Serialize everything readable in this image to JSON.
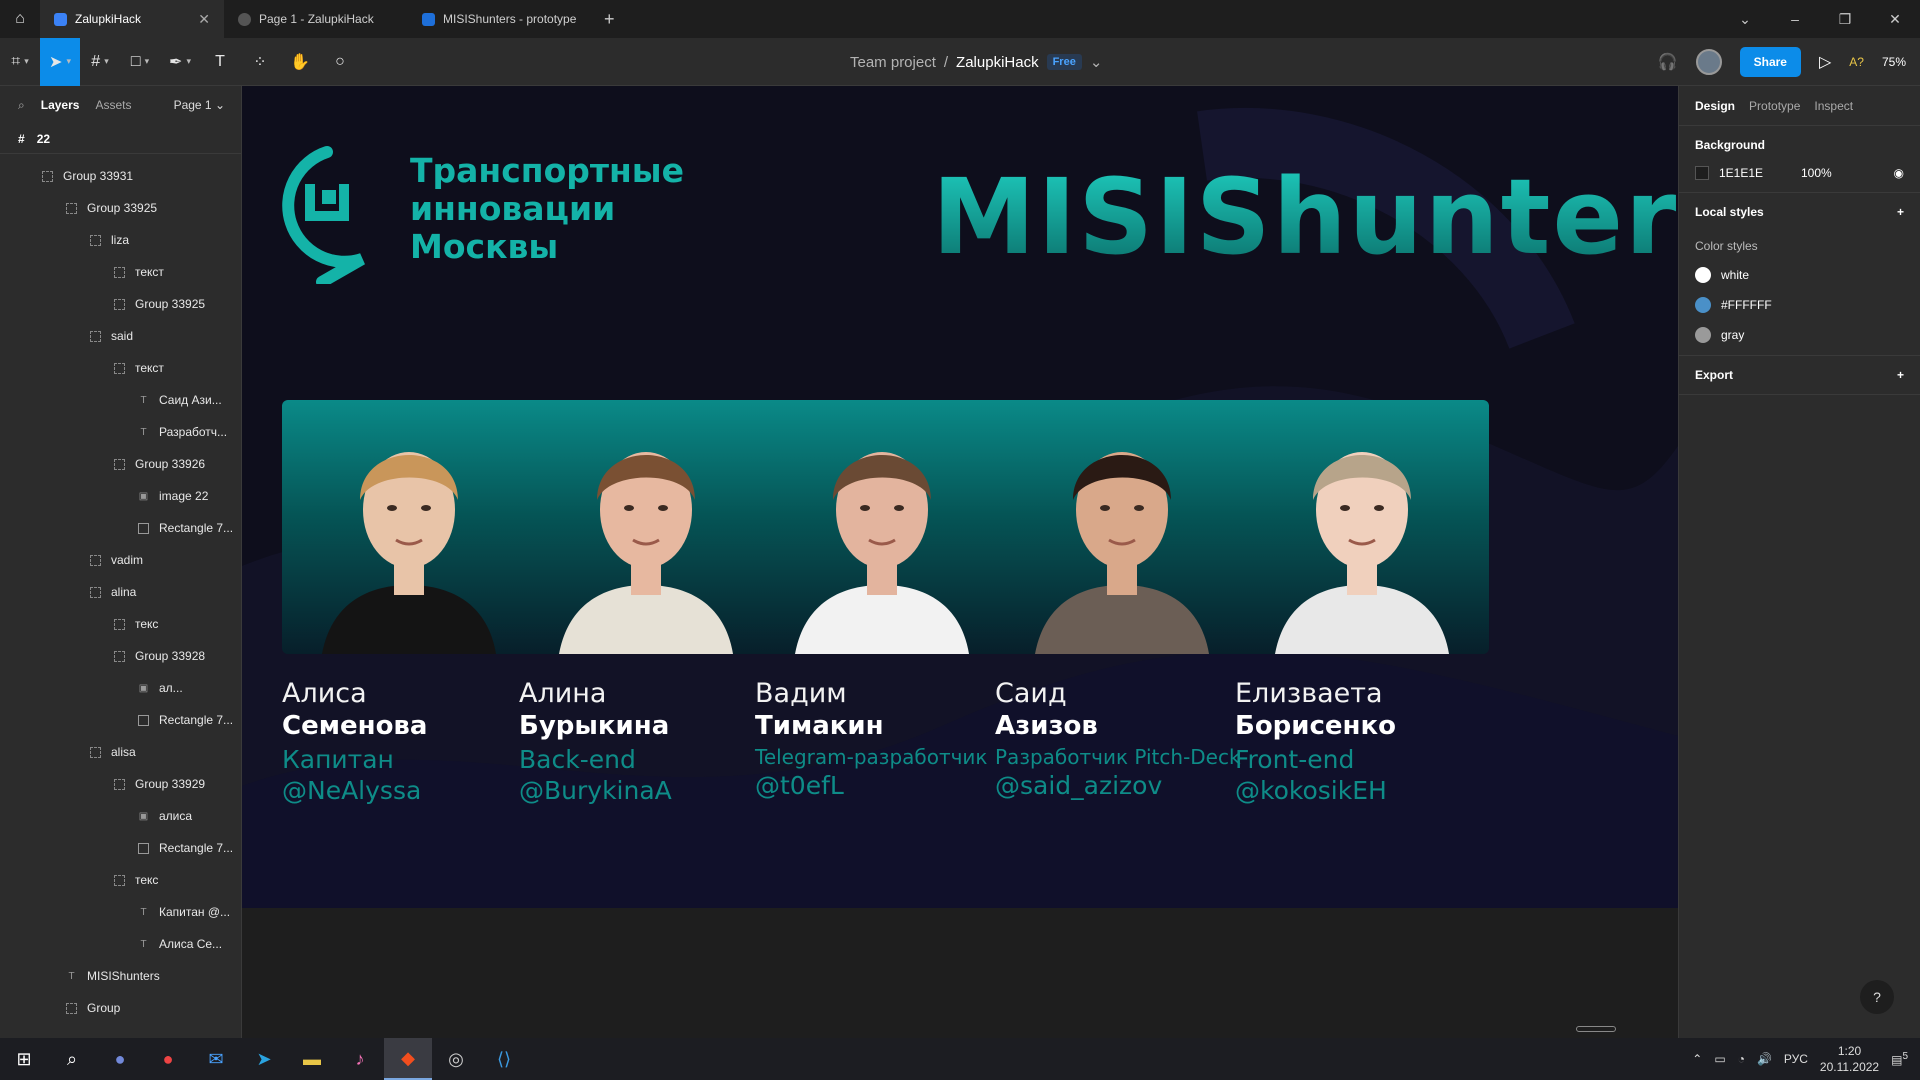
{
  "tabs": [
    {
      "label": "ZalupkiHack",
      "active": true
    },
    {
      "label": "Page 1 - ZalupkiHack",
      "active": false
    },
    {
      "label": "MISIShunters - prototype",
      "active": false
    }
  ],
  "toolbar": {
    "breadcrumb_team": "Team project",
    "breadcrumb_sep": "/",
    "file_name": "ZalupkiHack",
    "plan_badge": "Free",
    "share_label": "Share",
    "font_check": "A?",
    "zoom": "75%"
  },
  "left": {
    "tab_layers": "Layers",
    "tab_assets": "Assets",
    "page": "Page 1",
    "frame": "22",
    "layers": [
      {
        "label": "Group 33931",
        "depth": 1,
        "icon": "grp"
      },
      {
        "label": "Group 33925",
        "depth": 2,
        "icon": "grp"
      },
      {
        "label": "liza",
        "depth": 3,
        "icon": "grp"
      },
      {
        "label": "текст",
        "depth": 4,
        "icon": "grp"
      },
      {
        "label": "Group 33925",
        "depth": 4,
        "icon": "grp"
      },
      {
        "label": "said",
        "depth": 3,
        "icon": "grp"
      },
      {
        "label": "текст",
        "depth": 4,
        "icon": "grp"
      },
      {
        "label": "Саид Ази...",
        "depth": 5,
        "icon": "text"
      },
      {
        "label": "Разработч...",
        "depth": 5,
        "icon": "text"
      },
      {
        "label": "Group 33926",
        "depth": 4,
        "icon": "grp"
      },
      {
        "label": "image 22",
        "depth": 5,
        "icon": "img"
      },
      {
        "label": "Rectangle 7...",
        "depth": 5,
        "icon": "rect"
      },
      {
        "label": "vadim",
        "depth": 3,
        "icon": "grp"
      },
      {
        "label": "alina",
        "depth": 3,
        "icon": "grp"
      },
      {
        "label": "текс",
        "depth": 4,
        "icon": "grp"
      },
      {
        "label": "Group 33928",
        "depth": 4,
        "icon": "grp"
      },
      {
        "label": "ал...",
        "depth": 5,
        "icon": "img"
      },
      {
        "label": "Rectangle 7...",
        "depth": 5,
        "icon": "rect"
      },
      {
        "label": "alisa",
        "depth": 3,
        "icon": "grp"
      },
      {
        "label": "Group 33929",
        "depth": 4,
        "icon": "grp"
      },
      {
        "label": "алиса",
        "depth": 5,
        "icon": "img"
      },
      {
        "label": "Rectangle 7...",
        "depth": 5,
        "icon": "rect"
      },
      {
        "label": "текс",
        "depth": 4,
        "icon": "grp"
      },
      {
        "label": "Капитан @...",
        "depth": 5,
        "icon": "text"
      },
      {
        "label": "Алиса Се...",
        "depth": 5,
        "icon": "text"
      },
      {
        "label": "MISIShunters",
        "depth": 2,
        "icon": "text"
      },
      {
        "label": "Group",
        "depth": 2,
        "icon": "grp"
      }
    ]
  },
  "artboard": {
    "logo_line1": "Транспортные",
    "logo_line2": "инновации",
    "logo_line3": "Москвы",
    "brand": "MISIShunters",
    "members": [
      {
        "first": "Алиса",
        "last": "Семенова",
        "role": "Капитан",
        "handle": "@NeAlyssa",
        "skin": "#e8c4a8",
        "hair": "#c9965a",
        "shirt": "#141414"
      },
      {
        "first": "Алина",
        "last": "Бурыкина",
        "role": "Back-end",
        "handle": "@BurykinaA",
        "skin": "#e7b8a0",
        "hair": "#7a5033",
        "shirt": "#e6e1d6"
      },
      {
        "first": "Вадим",
        "last": "Тимакин",
        "role": "Telegram-разработчик",
        "handle": "@t0efL",
        "skin": "#e3b49e",
        "hair": "#6a4a34",
        "shirt": "#f2f2f2"
      },
      {
        "first": "Саид",
        "last": "Азизов",
        "role": "Разработчик Pitch-Deck",
        "handle": "@said_azizov",
        "skin": "#d9a88a",
        "hair": "#2a1a14",
        "shirt": "#6b5e55"
      },
      {
        "first": "Елизваета",
        "last": "Борисенко",
        "role": "Front-end",
        "handle": "@kokosikEH",
        "skin": "#f0d0bd",
        "hair": "#b7a48a",
        "shirt": "#e8e8e8"
      }
    ],
    "colors": {
      "accent": "#14b3a8",
      "role": "#0e8c88",
      "bg": "#0e0e1c"
    }
  },
  "right": {
    "tab_design": "Design",
    "tab_prototype": "Prototype",
    "tab_inspect": "Inspect",
    "background_title": "Background",
    "bg_hex": "1E1E1E",
    "bg_opacity": "100%",
    "local_styles": "Local styles",
    "color_styles": "Color styles",
    "styles": [
      {
        "name": "white",
        "color": "#ffffff"
      },
      {
        "name": "#FFFFFF",
        "color": "#4a90c8"
      },
      {
        "name": "gray",
        "color": "#9a9a9a"
      }
    ],
    "export": "Export",
    "help": "?"
  },
  "taskbar": {
    "lang": "РУС",
    "time": "1:20",
    "date": "20.11.2022",
    "notifications": "5"
  }
}
